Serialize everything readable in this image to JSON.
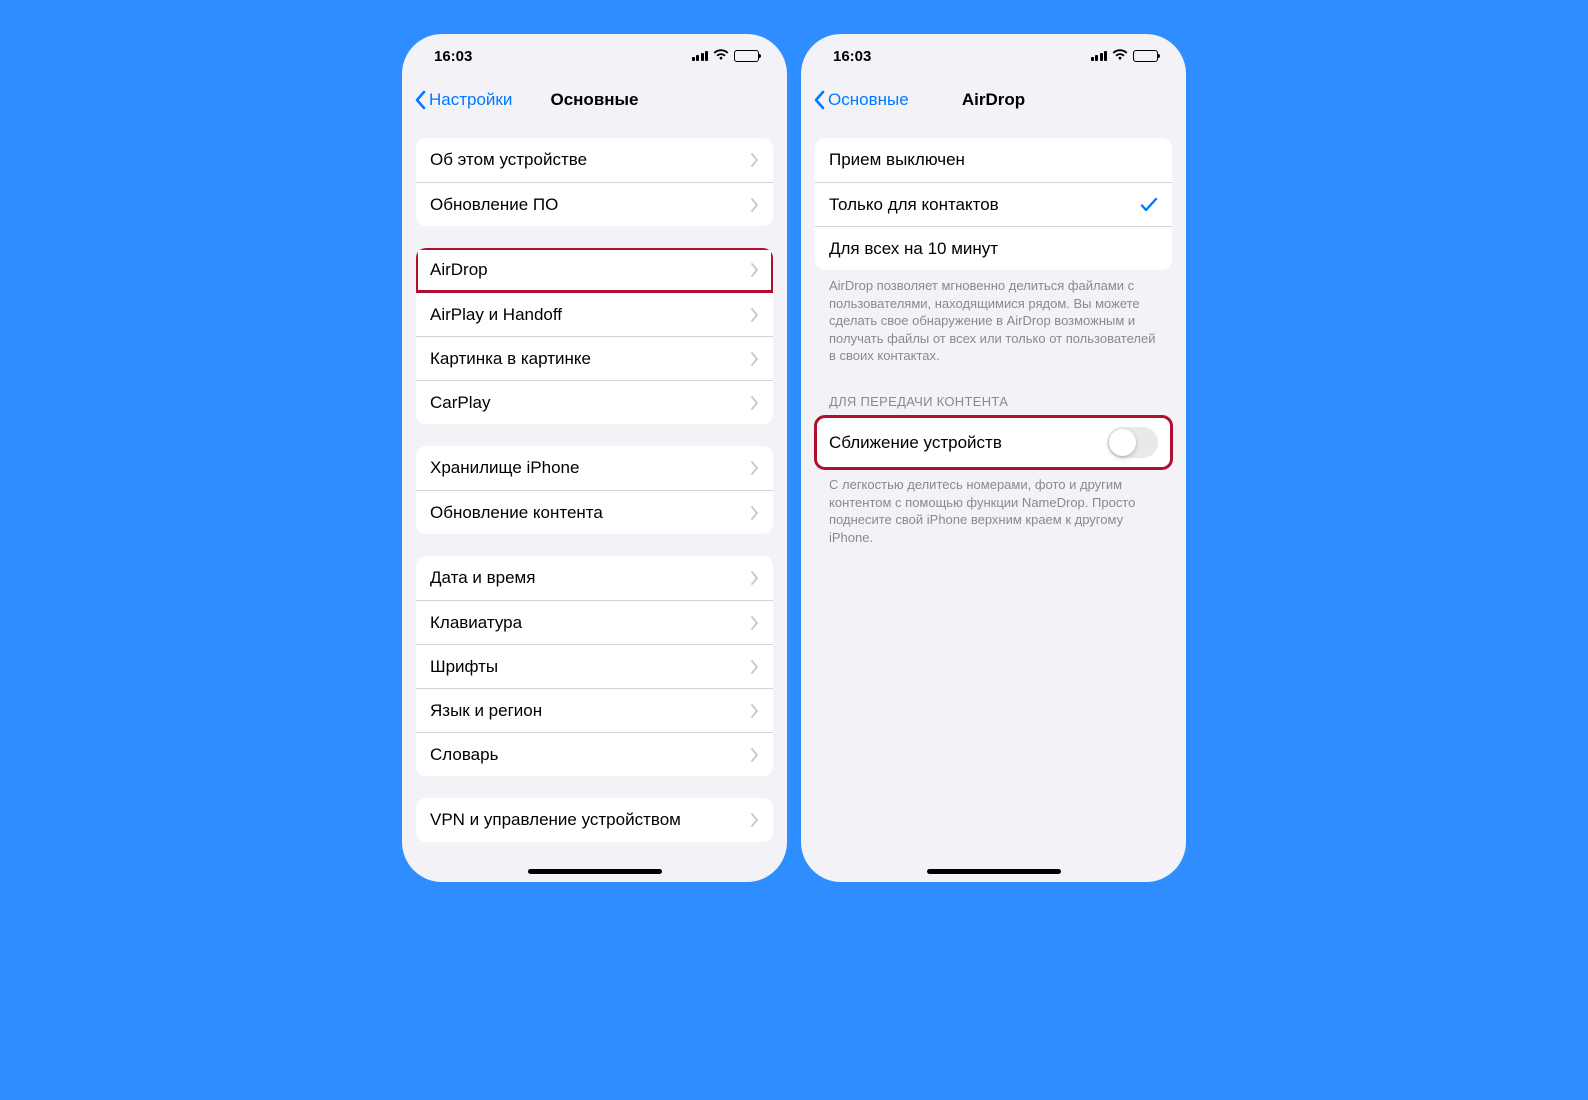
{
  "status": {
    "time": "16:03"
  },
  "phone1": {
    "back": "Настройки",
    "title": "Основные",
    "groups": [
      {
        "rows": [
          "Об этом устройстве",
          "Обновление ПО"
        ]
      },
      {
        "rows": [
          "AirDrop",
          "AirPlay и Handoff",
          "Картинка в картинке",
          "CarPlay"
        ],
        "highlight_index": 0
      },
      {
        "rows": [
          "Хранилище iPhone",
          "Обновление контента"
        ]
      },
      {
        "rows": [
          "Дата и время",
          "Клавиатура",
          "Шрифты",
          "Язык и регион",
          "Словарь"
        ]
      },
      {
        "rows": [
          "VPN и управление устройством"
        ]
      }
    ]
  },
  "phone2": {
    "back": "Основные",
    "title": "AirDrop",
    "receive_options": {
      "rows": [
        "Прием выключен",
        "Только для контактов",
        "Для всех на 10 минут"
      ],
      "selected_index": 1,
      "footer": "AirDrop позволяет мгновенно делиться файлами с пользователями, находящимися рядом. Вы можете сделать свое обнаружение в AirDrop возможным и получать файлы от всех или только от пользователей в своих контактах."
    },
    "transfer_section": {
      "header": "ДЛЯ ПЕРЕДАЧИ КОНТЕНТА",
      "toggle_label": "Сближение устройств",
      "toggle_on": false,
      "highlighted": true,
      "footer": "С легкостью делитесь номерами, фото и другим контентом с помощью функции NameDrop. Просто поднесите свой iPhone верхним краем к другому iPhone."
    }
  }
}
